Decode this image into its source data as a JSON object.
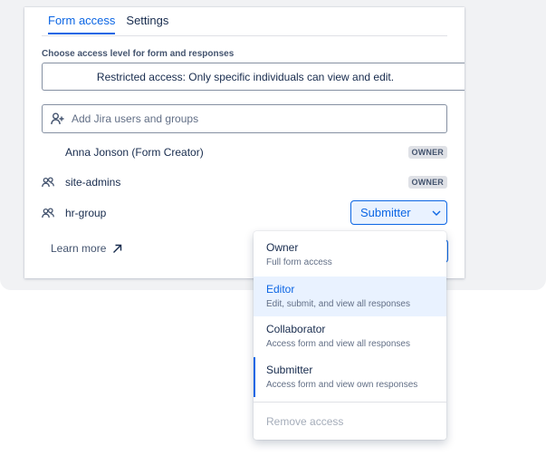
{
  "tabs": [
    {
      "label": "Form access",
      "active": true
    },
    {
      "label": "Settings",
      "active": false
    }
  ],
  "access": {
    "section_label": "Choose access level for form and responses",
    "selected": "Restricted access: Only specific individuals can view and edit."
  },
  "picker": {
    "placeholder": "Add Jira users and groups",
    "icon": "add-user-icon"
  },
  "members": [
    {
      "name": "Anna Jonson (Form Creator)",
      "role": "OWNER",
      "icon": ""
    },
    {
      "name": "site-admins",
      "role": "OWNER",
      "icon": "group-icon"
    },
    {
      "name": "hr-group",
      "role": "Submitter",
      "icon": "group-icon"
    }
  ],
  "learn_more": {
    "label": "Learn more",
    "icon": "arrow-up-right-icon"
  },
  "menu": {
    "items": [
      {
        "title": "Owner",
        "desc": "Full form access"
      },
      {
        "title": "Editor",
        "desc": "Edit, submit, and view all responses"
      },
      {
        "title": "Collaborator",
        "desc": "Access form and view all responses"
      },
      {
        "title": "Submitter",
        "desc": "Access form and view own responses"
      }
    ],
    "highlighted": "Editor",
    "selected": "Submitter",
    "remove_label": "Remove access"
  },
  "colors": {
    "accent": "#0c66e4",
    "highlight_bg": "#e9f2ff",
    "badge_bg": "#dfe1e6",
    "text": "#172b4d",
    "muted": "#626f86",
    "disabled": "#a5adba"
  }
}
